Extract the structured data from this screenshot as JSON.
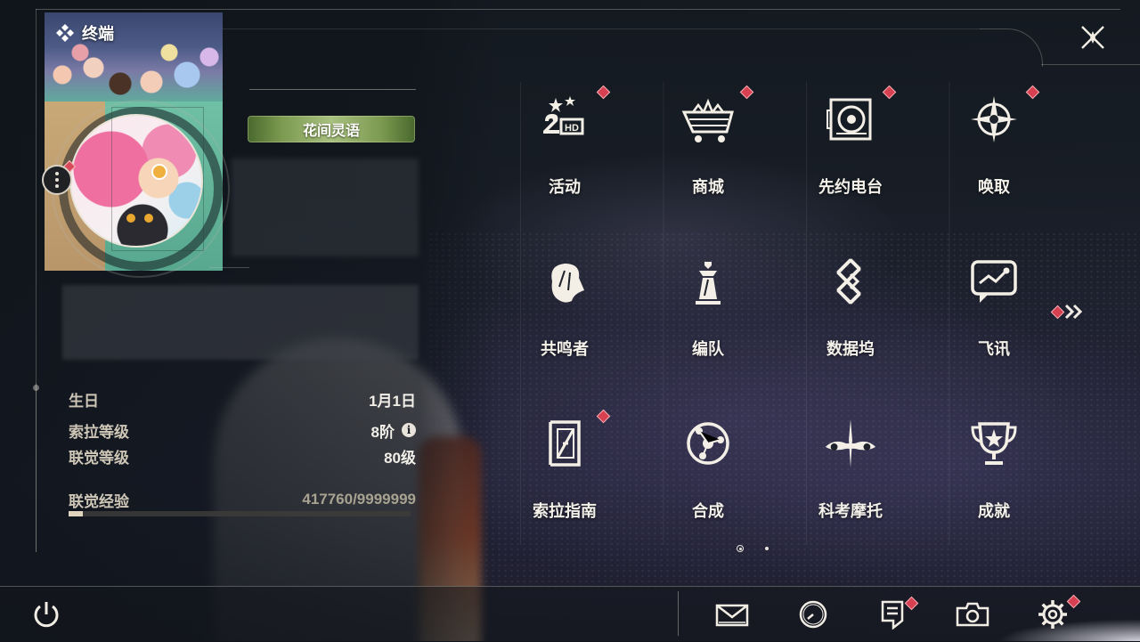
{
  "header": {
    "title": "终端"
  },
  "profile": {
    "title_badge": "花间灵语",
    "stats": [
      {
        "label": "生日",
        "value": "1月1日"
      },
      {
        "label": "索拉等级",
        "value": "8阶"
      },
      {
        "label": "联觉等级",
        "value": "80级"
      }
    ],
    "exp": {
      "label": "联觉经验",
      "value": "417760/9999999",
      "progress": 0.0418
    }
  },
  "menu": [
    {
      "label": "活动",
      "icon": "event-2nd-anniversary-icon",
      "badge": true
    },
    {
      "label": "商城",
      "icon": "shop-cart-icon",
      "badge": true
    },
    {
      "label": "先约电台",
      "icon": "radio-icon",
      "badge": true
    },
    {
      "label": "唤取",
      "icon": "convene-icon",
      "badge": true
    },
    {
      "label": "共鸣者",
      "icon": "resonator-icon",
      "badge": false
    },
    {
      "label": "编队",
      "icon": "team-chess-icon",
      "badge": false
    },
    {
      "label": "数据坞",
      "icon": "data-bank-icon",
      "badge": false
    },
    {
      "label": "飞讯",
      "icon": "chat-icon",
      "badge": false
    },
    {
      "label": "索拉指南",
      "icon": "guidebook-icon",
      "badge": true
    },
    {
      "label": "合成",
      "icon": "synthesis-icon",
      "badge": false
    },
    {
      "label": "科考摩托",
      "icon": "motorcycle-icon",
      "badge": false
    },
    {
      "label": "成就",
      "icon": "trophy-icon",
      "badge": false
    }
  ],
  "pager": {
    "current": 1,
    "total": 2
  },
  "colors": {
    "accent_red": "#d64050",
    "text": "#f4f1ea",
    "title_badge_green": "#7c9a50"
  }
}
